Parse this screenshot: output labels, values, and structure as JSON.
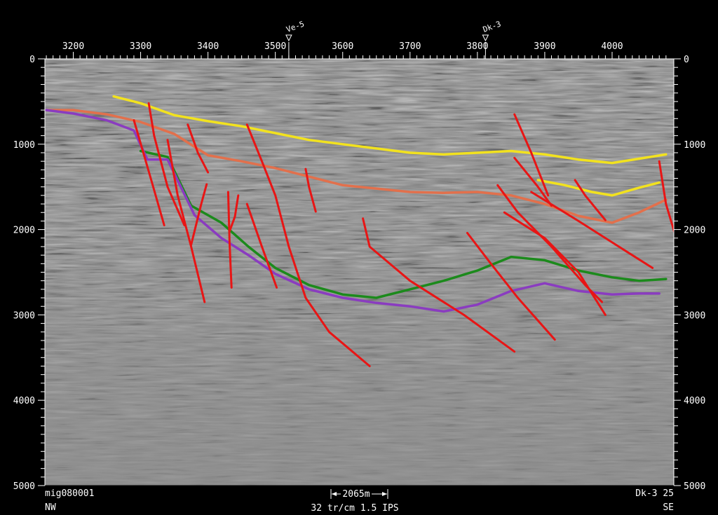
{
  "top_axis": {
    "ticks": [
      "3200",
      "3300",
      "3400",
      "3500",
      "3600",
      "3700",
      "3800",
      "3900",
      "4000"
    ]
  },
  "wells": [
    {
      "name": "Ve-5",
      "trace": 3520
    },
    {
      "name": "Dk-3",
      "trace": 3812
    }
  ],
  "time_axis": {
    "ticks": [
      "0",
      "1000",
      "2000",
      "3000",
      "4000",
      "5000"
    ]
  },
  "footer": {
    "line_id": "mig080001",
    "scale_bar": "2065m",
    "display_params": "32 tr/cm 1.5 IPS",
    "well_ref": "Dk-3 25",
    "left_direction": "NW",
    "right_direction": "SE"
  },
  "colors": {
    "background": "#000000",
    "section": "#8c8c8c",
    "horizon_yellow": "#f2e21e",
    "horizon_orange": "#e2704c",
    "horizon_green": "#1c8a1c",
    "horizon_purple": "#8a3cc0",
    "fault_red": "#e81515"
  },
  "horizons": [
    {
      "name": "yellow-horizon",
      "color": "#f2e21e",
      "points": [
        [
          3260,
          440
        ],
        [
          3300,
          520
        ],
        [
          3350,
          660
        ],
        [
          3400,
          730
        ],
        [
          3450,
          790
        ],
        [
          3500,
          870
        ],
        [
          3550,
          950
        ],
        [
          3600,
          1000
        ],
        [
          3650,
          1050
        ],
        [
          3700,
          1100
        ],
        [
          3750,
          1120
        ],
        [
          3800,
          1100
        ],
        [
          3850,
          1080
        ],
        [
          3900,
          1120
        ],
        [
          3950,
          1180
        ],
        [
          4000,
          1220
        ],
        [
          4040,
          1170
        ],
        [
          4080,
          1120
        ]
      ]
    },
    {
      "name": "yellow-horizon-lower",
      "color": "#f2e21e",
      "points": [
        [
          3890,
          1420
        ],
        [
          3930,
          1480
        ],
        [
          3970,
          1560
        ],
        [
          4000,
          1600
        ],
        [
          4040,
          1510
        ],
        [
          4070,
          1450
        ]
      ]
    },
    {
      "name": "orange-horizon",
      "color": "#e2704c",
      "points": [
        [
          3160,
          600
        ],
        [
          3200,
          600
        ],
        [
          3250,
          650
        ],
        [
          3300,
          740
        ],
        [
          3350,
          880
        ],
        [
          3400,
          1130
        ],
        [
          3450,
          1200
        ],
        [
          3500,
          1280
        ],
        [
          3550,
          1380
        ],
        [
          3600,
          1480
        ],
        [
          3650,
          1520
        ],
        [
          3700,
          1560
        ],
        [
          3750,
          1570
        ],
        [
          3800,
          1560
        ],
        [
          3850,
          1600
        ],
        [
          3900,
          1700
        ],
        [
          3950,
          1840
        ],
        [
          4000,
          1920
        ],
        [
          4040,
          1800
        ],
        [
          4080,
          1650
        ]
      ]
    },
    {
      "name": "green-horizon",
      "color": "#1c8a1c",
      "points": [
        [
          3300,
          1080
        ],
        [
          3340,
          1150
        ],
        [
          3375,
          1720
        ],
        [
          3420,
          1920
        ],
        [
          3460,
          2200
        ],
        [
          3500,
          2450
        ],
        [
          3550,
          2650
        ],
        [
          3600,
          2760
        ],
        [
          3650,
          2800
        ],
        [
          3700,
          2700
        ],
        [
          3750,
          2600
        ],
        [
          3800,
          2480
        ],
        [
          3850,
          2320
        ],
        [
          3900,
          2360
        ],
        [
          3950,
          2480
        ],
        [
          4000,
          2560
        ],
        [
          4040,
          2600
        ],
        [
          4080,
          2580
        ]
      ]
    },
    {
      "name": "purple-horizon",
      "color": "#8a3cc0",
      "points": [
        [
          3160,
          600
        ],
        [
          3200,
          640
        ],
        [
          3250,
          720
        ],
        [
          3290,
          840
        ],
        [
          3310,
          1180
        ],
        [
          3340,
          1180
        ],
        [
          3380,
          1830
        ],
        [
          3420,
          2100
        ],
        [
          3460,
          2300
        ],
        [
          3500,
          2520
        ],
        [
          3550,
          2700
        ],
        [
          3600,
          2800
        ],
        [
          3650,
          2860
        ],
        [
          3700,
          2900
        ],
        [
          3750,
          2960
        ],
        [
          3800,
          2880
        ],
        [
          3850,
          2720
        ],
        [
          3900,
          2630
        ],
        [
          3950,
          2720
        ],
        [
          4000,
          2760
        ],
        [
          4040,
          2750
        ],
        [
          4070,
          2750
        ]
      ]
    }
  ],
  "faults": [
    {
      "name": "fault-1",
      "points": [
        [
          3312,
          520
        ],
        [
          3320,
          900
        ],
        [
          3340,
          1500
        ],
        [
          3365,
          1950
        ]
      ]
    },
    {
      "name": "fault-2",
      "points": [
        [
          3290,
          720
        ],
        [
          3315,
          1400
        ],
        [
          3335,
          1950
        ]
      ]
    },
    {
      "name": "fault-3",
      "points": [
        [
          3340,
          950
        ],
        [
          3355,
          1600
        ],
        [
          3375,
          2200
        ],
        [
          3395,
          2850
        ]
      ]
    },
    {
      "name": "fault-4",
      "points": [
        [
          3370,
          770
        ],
        [
          3385,
          1100
        ],
        [
          3400,
          1330
        ]
      ]
    },
    {
      "name": "fault-5",
      "points": [
        [
          3398,
          1470
        ],
        [
          3390,
          1700
        ],
        [
          3375,
          2180
        ]
      ]
    },
    {
      "name": "fault-6",
      "points": [
        [
          3430,
          1560
        ],
        [
          3432,
          2150
        ],
        [
          3435,
          2680
        ]
      ]
    },
    {
      "name": "fault-7",
      "points": [
        [
          3445,
          1600
        ],
        [
          3440,
          1850
        ],
        [
          3432,
          2020
        ]
      ]
    },
    {
      "name": "fault-8",
      "points": [
        [
          3458,
          770
        ],
        [
          3480,
          1200
        ],
        [
          3500,
          1600
        ],
        [
          3520,
          2200
        ],
        [
          3545,
          2800
        ],
        [
          3580,
          3200
        ],
        [
          3640,
          3600
        ]
      ]
    },
    {
      "name": "fault-9",
      "points": [
        [
          3458,
          1700
        ],
        [
          3480,
          2200
        ],
        [
          3502,
          2680
        ]
      ]
    },
    {
      "name": "fault-10",
      "points": [
        [
          3545,
          1290
        ],
        [
          3550,
          1500
        ],
        [
          3560,
          1790
        ]
      ]
    },
    {
      "name": "fault-11",
      "points": [
        [
          3630,
          1870
        ],
        [
          3640,
          2200
        ],
        [
          3700,
          2600
        ],
        [
          3780,
          3000
        ],
        [
          3855,
          3430
        ]
      ]
    },
    {
      "name": "fault-12",
      "points": [
        [
          3785,
          2040
        ],
        [
          3820,
          2400
        ],
        [
          3860,
          2800
        ],
        [
          3915,
          3290
        ]
      ]
    },
    {
      "name": "fault-13",
      "points": [
        [
          3830,
          1480
        ],
        [
          3860,
          1800
        ],
        [
          3910,
          2200
        ],
        [
          3960,
          2650
        ],
        [
          3985,
          2850
        ]
      ]
    },
    {
      "name": "fault-14",
      "points": [
        [
          3840,
          1800
        ],
        [
          3900,
          2100
        ],
        [
          3950,
          2500
        ],
        [
          3990,
          3000
        ]
      ]
    },
    {
      "name": "fault-15",
      "points": [
        [
          3855,
          650
        ],
        [
          3880,
          1100
        ],
        [
          3905,
          1600
        ]
      ]
    },
    {
      "name": "fault-16",
      "points": [
        [
          3855,
          1160
        ],
        [
          3890,
          1500
        ],
        [
          3910,
          1720
        ]
      ]
    },
    {
      "name": "fault-17",
      "points": [
        [
          3880,
          1560
        ],
        [
          3950,
          1900
        ],
        [
          4000,
          2150
        ],
        [
          4060,
          2450
        ]
      ]
    },
    {
      "name": "fault-18",
      "points": [
        [
          3945,
          1420
        ],
        [
          3960,
          1600
        ],
        [
          3990,
          1890
        ]
      ]
    },
    {
      "name": "fault-19",
      "points": [
        [
          4070,
          1200
        ],
        [
          4080,
          1700
        ],
        [
          4105,
          2360
        ]
      ]
    }
  ]
}
